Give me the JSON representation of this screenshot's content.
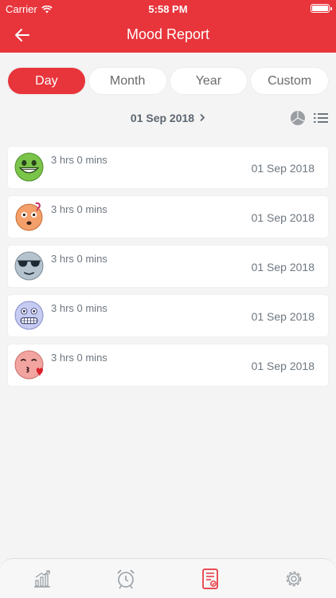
{
  "status": {
    "carrier": "Carrier",
    "time": "5:58 PM"
  },
  "header": {
    "title": "Mood Report",
    "back_icon": "back-arrow-icon"
  },
  "segments": [
    {
      "label": "Day",
      "active": true
    },
    {
      "label": "Month",
      "active": false
    },
    {
      "label": "Year",
      "active": false
    },
    {
      "label": "Custom",
      "active": false
    }
  ],
  "date_selector": {
    "date": "01 Sep 2018",
    "next_icon": "chevron-right-icon"
  },
  "view_toggles": {
    "chart_icon": "pie-chart-icon",
    "list_icon": "list-icon"
  },
  "entries": [
    {
      "mood_icon": "grinning-face-icon",
      "duration": "3 hrs 0 mins",
      "date": "01 Sep 2018"
    },
    {
      "mood_icon": "confused-face-icon",
      "duration": "3 hrs 0 mins",
      "date": "01 Sep 2018"
    },
    {
      "mood_icon": "sunglasses-face-icon",
      "duration": "3 hrs 0 mins",
      "date": "01 Sep 2018"
    },
    {
      "mood_icon": "grimacing-face-icon",
      "duration": "3 hrs 0 mins",
      "date": "01 Sep 2018"
    },
    {
      "mood_icon": "kissing-face-icon",
      "duration": "3 hrs 0 mins",
      "date": "01 Sep 2018"
    }
  ],
  "tabbar": [
    {
      "icon": "stats-icon",
      "active": false
    },
    {
      "icon": "alarm-clock-icon",
      "active": false
    },
    {
      "icon": "report-icon",
      "active": true
    },
    {
      "icon": "gear-icon",
      "active": false
    }
  ],
  "colors": {
    "accent": "#e8353c",
    "background": "#f4f4f4",
    "text_muted": "#6e7780"
  }
}
